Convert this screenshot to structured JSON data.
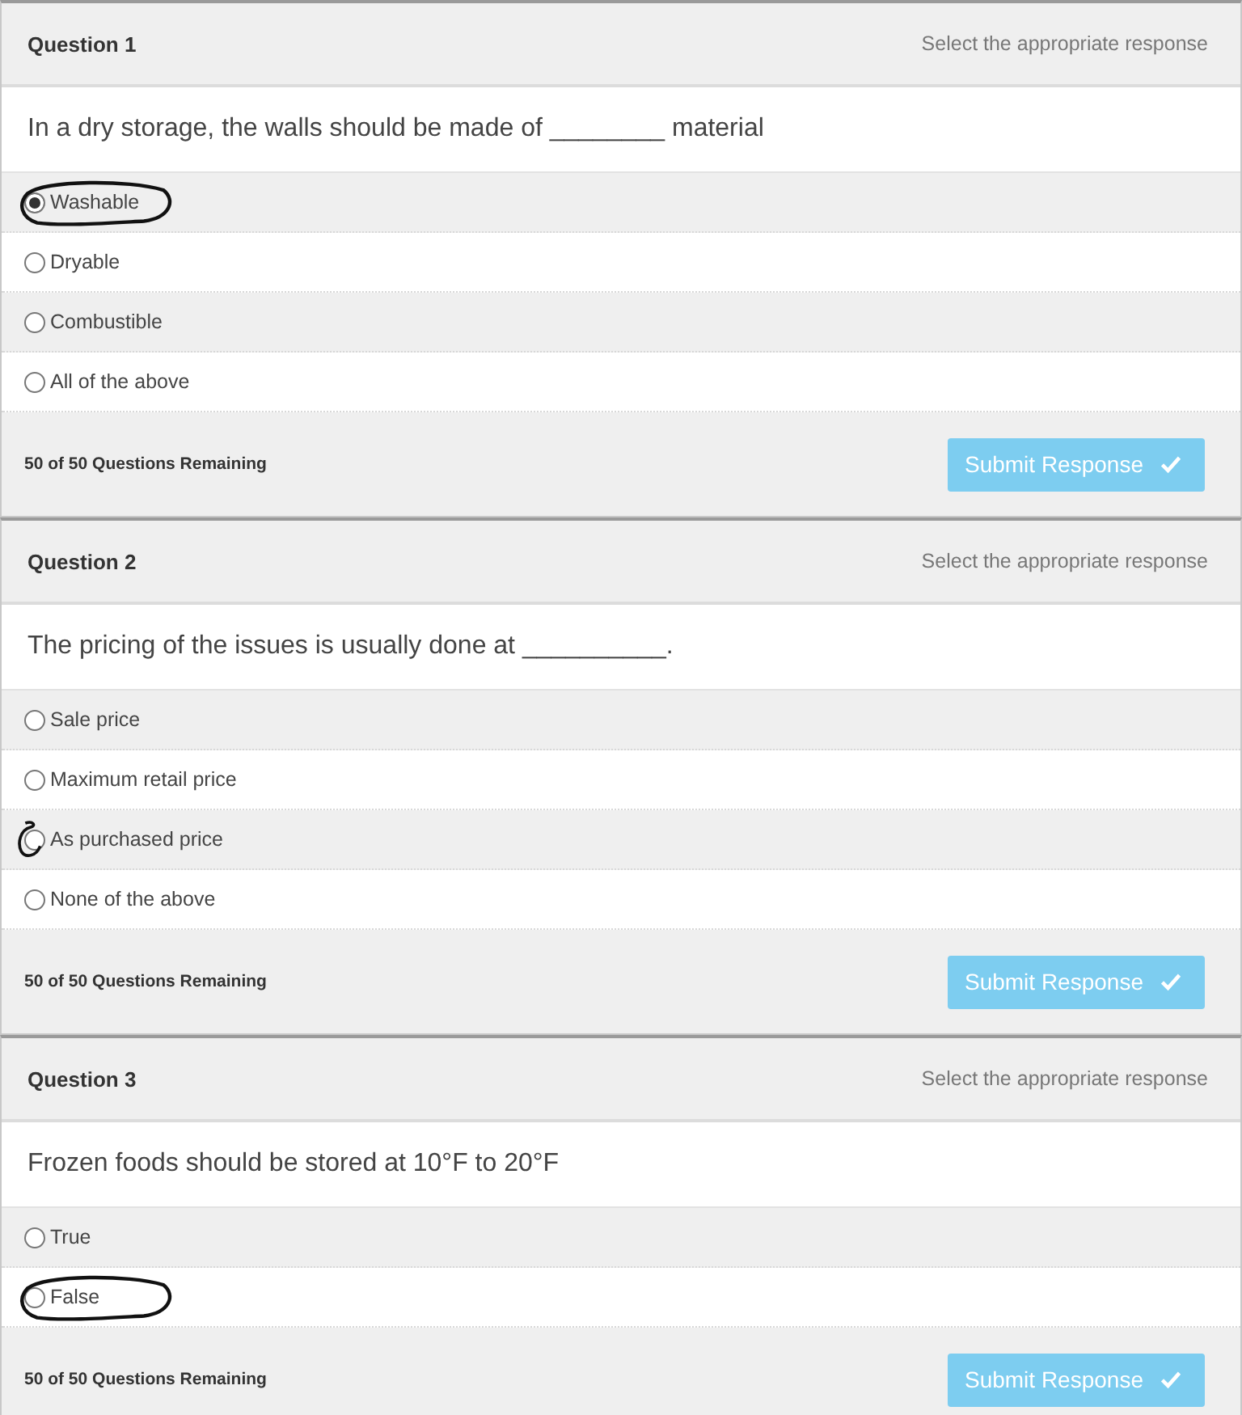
{
  "questions": [
    {
      "title": "Question 1",
      "instruction": "Select the appropriate response",
      "prompt": "In a dry storage, the walls should be made of ________ material",
      "options": [
        {
          "label": "Washable",
          "selected": true,
          "label_circled": true,
          "radio_circled": false
        },
        {
          "label": "Dryable",
          "selected": false,
          "label_circled": false,
          "radio_circled": false
        },
        {
          "label": "Combustible",
          "selected": false,
          "label_circled": false,
          "radio_circled": false
        },
        {
          "label": "All of the above",
          "selected": false,
          "label_circled": false,
          "radio_circled": false
        }
      ],
      "remaining": "50 of 50 Questions Remaining",
      "submit": "Submit Response"
    },
    {
      "title": "Question 2",
      "instruction": "Select the appropriate response",
      "prompt": "The pricing of the issues is usually done at __________.",
      "options": [
        {
          "label": "Sale price",
          "selected": false,
          "label_circled": false,
          "radio_circled": false
        },
        {
          "label": "Maximum retail price",
          "selected": false,
          "label_circled": false,
          "radio_circled": false
        },
        {
          "label": "As purchased price",
          "selected": false,
          "label_circled": false,
          "radio_circled": true
        },
        {
          "label": "None of the above",
          "selected": false,
          "label_circled": false,
          "radio_circled": false
        }
      ],
      "remaining": "50 of 50 Questions Remaining",
      "submit": "Submit Response"
    },
    {
      "title": "Question 3",
      "instruction": "Select the appropriate response",
      "prompt": "Frozen foods should be stored at 10°F to 20°F",
      "options": [
        {
          "label": "True",
          "selected": false,
          "label_circled": false,
          "radio_circled": false
        },
        {
          "label": "False",
          "selected": false,
          "label_circled": true,
          "radio_circled": false
        }
      ],
      "remaining": "50 of 50 Questions Remaining",
      "submit": "Submit Response"
    }
  ]
}
